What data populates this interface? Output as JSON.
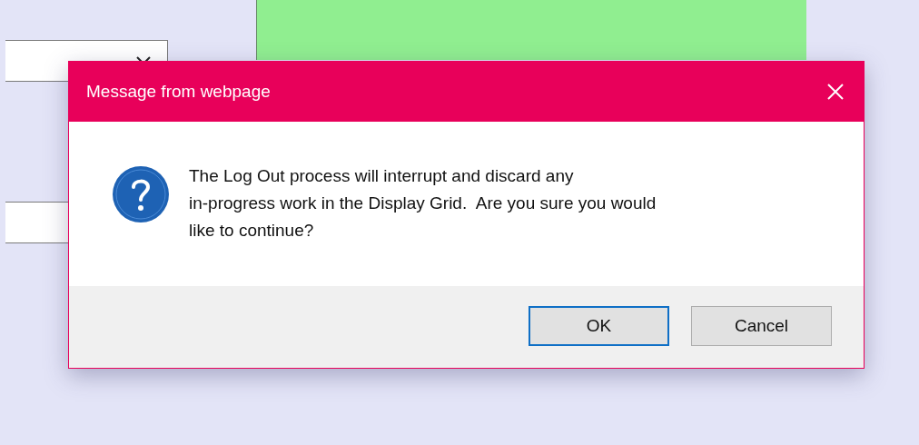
{
  "dialog": {
    "title": "Message from webpage",
    "message": "The Log Out process will interrupt and discard any\nin-progress work in the Display Grid.  Are you sure you would\nlike to continue?",
    "buttons": [
      {
        "label": "OK",
        "focused": true
      },
      {
        "label": "Cancel",
        "focused": false
      }
    ]
  }
}
